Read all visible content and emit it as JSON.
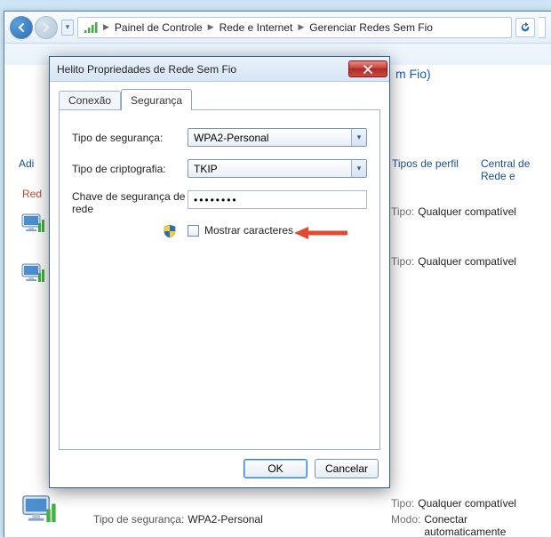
{
  "breadcrumb": {
    "item1": "Painel de Controle",
    "item2": "Rede e Internet",
    "item3": "Gerenciar Redes Sem Fio"
  },
  "page": {
    "title_fragment": "m Fio)",
    "toolbar_add": "Adi",
    "toolbar_profile": "Tipos de perfil",
    "toolbar_center": "Central de Rede e",
    "side_label": "Red"
  },
  "list": {
    "tipo_label": "Tipo:",
    "tipo_value": "Qualquer compatível",
    "modo_label": "Modo:",
    "modo_value": "Conectar automaticamente"
  },
  "bottom": {
    "sec_label": "Tipo de segurança:",
    "sec_value": "WPA2-Personal"
  },
  "dialog": {
    "title": "Helito Propriedades de Rede Sem Fio",
    "tab_conexao": "Conexão",
    "tab_seguranca": "Segurança",
    "sec_type_label": "Tipo de segurança:",
    "sec_type_value": "WPA2-Personal",
    "crypt_label": "Tipo de criptografia:",
    "crypt_value": "TKIP",
    "key_label": "Chave de segurança de rede",
    "key_value": "••••••••",
    "show_chars": "Mostrar caracteres",
    "ok": "OK",
    "cancel": "Cancelar"
  }
}
